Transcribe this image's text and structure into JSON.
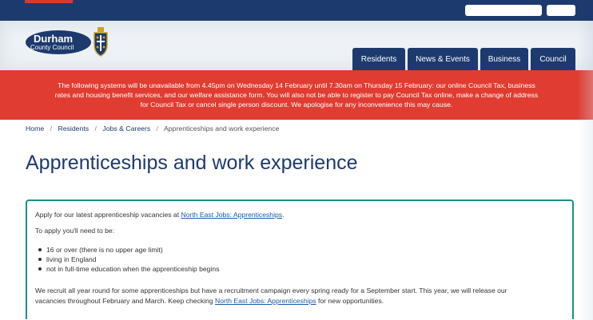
{
  "logo": {
    "name": "Durham",
    "subtitle": "County Council"
  },
  "nav": [
    {
      "label": "Residents"
    },
    {
      "label": "News & Events"
    },
    {
      "label": "Business"
    },
    {
      "label": "Council"
    }
  ],
  "alert": {
    "line1": "The following systems will be unavailable from 4.45pm on Wednesday 14 February until 7.30am on Thursday 15 February: our online Council Tax, business",
    "line2": "rates and housing benefit services, and our welfare assistance form. You will also not be able to register to pay Council Tax online, make a change of address",
    "line3": "for Council Tax or cancel single person discount. We apologise for any inconvenience this may cause."
  },
  "breadcrumb": [
    "Home",
    "Residents",
    "Jobs & Careers",
    "Apprenticeships and work experience"
  ],
  "breadcrumb_sep": "/",
  "page_title": "Apprenticeships and work experience",
  "content": {
    "intro_prefix": "Apply for our latest apprenticeship vacancies at ",
    "intro_link": "North East Jobs: Apprenticeships",
    "intro_suffix": ".",
    "requirements_heading": "To apply you'll need to be:",
    "requirements": [
      "16 or over (there is no upper age limit)",
      "living in England",
      "not in full-time education when the apprenticeship begins"
    ],
    "recruit_line1": "We recruit all year round for some apprenticeships but have a recruitment campaign every spring ready for a September start.  This year, we will release our",
    "recruit_line2_prefix": "vacancies throughout February and March.  Keep checking ",
    "recruit_link": "North East Jobs: Apprenticeships",
    "recruit_line2_suffix": " for new opportunities."
  },
  "colors": {
    "brand_navy": "#1d3a6e",
    "alert_red": "#e03c31",
    "box_teal": "#1b8f8a",
    "link_blue": "#1a5aa8"
  }
}
